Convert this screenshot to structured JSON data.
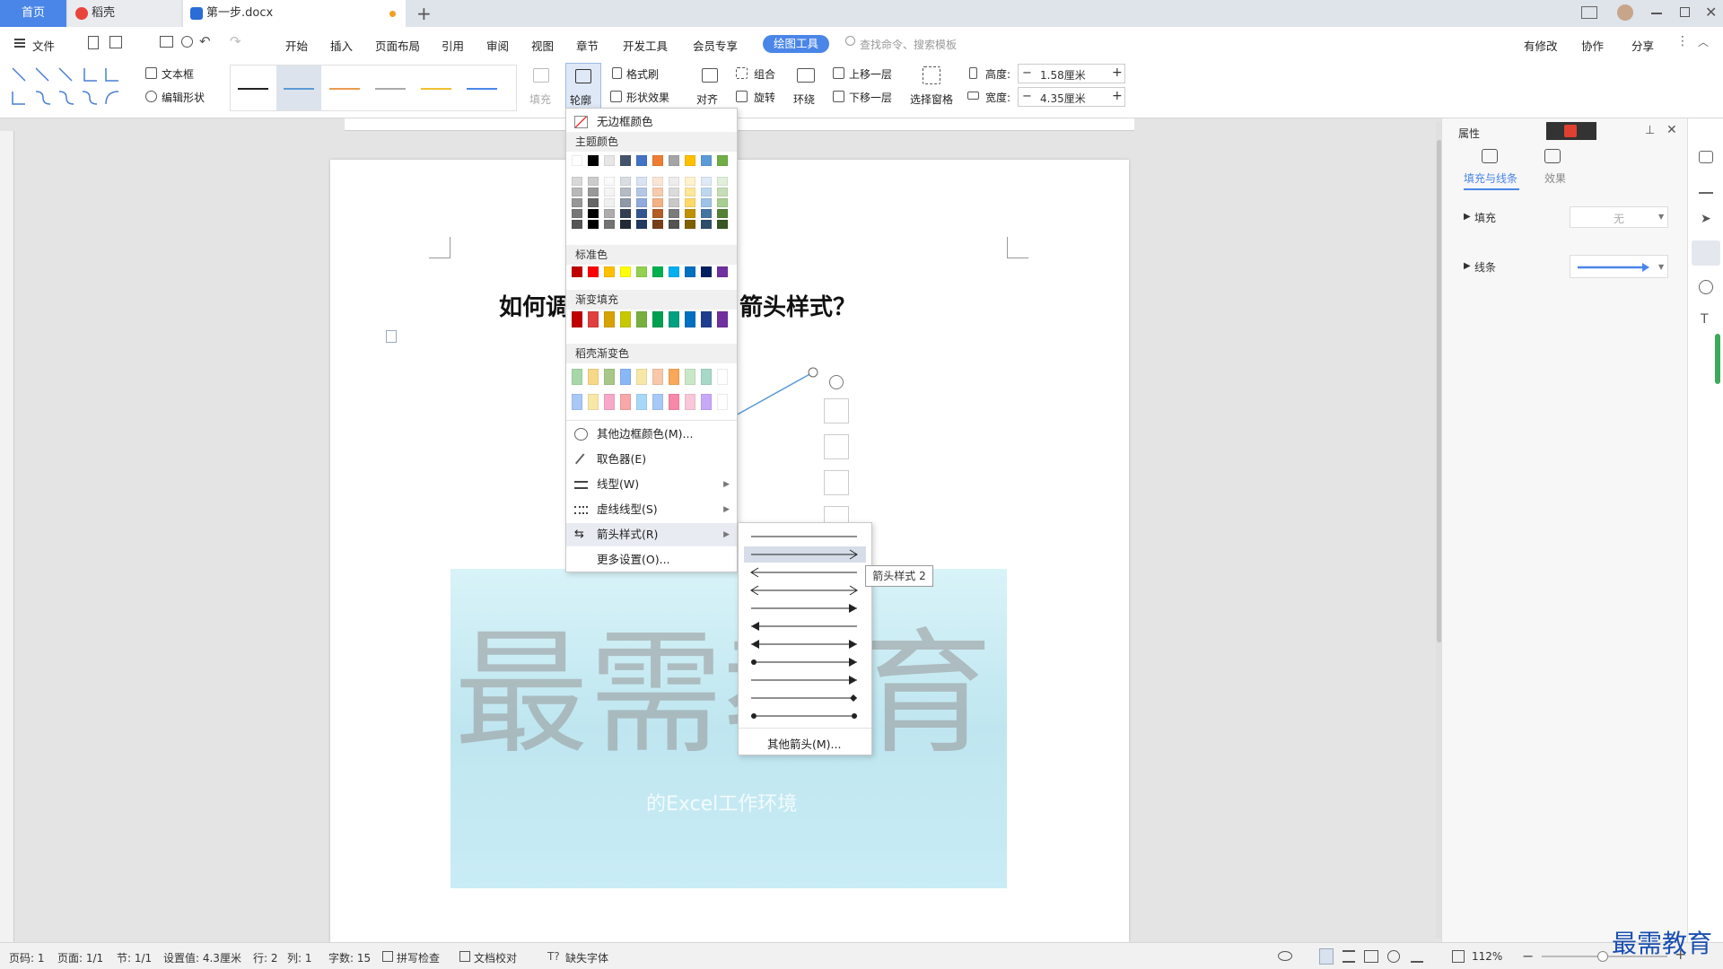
{
  "tabs": {
    "home": "首页",
    "daoke": "稻壳",
    "doc": "第一步.docx",
    "add": "+"
  },
  "menu": {
    "file": "文件",
    "items": [
      "开始",
      "插入",
      "页面布局",
      "引用",
      "审阅",
      "视图",
      "章节",
      "开发工具",
      "会员专享"
    ],
    "active_tool": "绘图工具",
    "search_placeholder": "查找命令、搜索模板",
    "right": [
      "有修改",
      "协作",
      "分享"
    ]
  },
  "ribbon": {
    "textbox": "文本框",
    "edit_shape": "编辑形状",
    "fill": "填充",
    "outline": "轮廓",
    "format_brush": "格式刷",
    "shape_effect": "形状效果",
    "align": "对齐",
    "group": "组合",
    "rotate": "旋转",
    "wrap": "环绕",
    "bring_forward": "上移一层",
    "send_backward": "下移一层",
    "selection_pane": "选择窗格",
    "height_label": "高度:",
    "height_value": "1.58厘米",
    "width_label": "宽度:",
    "width_value": "4.35厘米"
  },
  "document": {
    "title_left": "如何调",
    "title_right": "箭头样式？",
    "watermark_big": "最需教育",
    "watermark_sub": "的Excel工作环境"
  },
  "outline_menu": {
    "no_border": "无边框颜色",
    "theme_colors": "主题颜色",
    "standard_colors": "标准色",
    "gradient_fill": "渐变填充",
    "daoke_gradient": "稻壳渐变色",
    "more_colors": "其他边框颜色(M)...",
    "picker": "取色器(E)",
    "line_type": "线型(W)",
    "dash_type": "虚线线型(S)",
    "arrow_style": "箭头样式(R)",
    "more_settings": "更多设置(O)..."
  },
  "arrow_submenu": {
    "more_arrows": "其他箭头(M)...",
    "tooltip": "箭头样式 2"
  },
  "right_panel": {
    "title": "属性",
    "tab_fill": "填充与线条",
    "tab_effect": "效果",
    "fill_label": "填充",
    "fill_value": "无",
    "line_label": "线条"
  },
  "status": {
    "page_code": "页码: 1",
    "page": "页面: 1/1",
    "section": "节: 1/1",
    "setting": "设置值: 4.3厘米",
    "row": "行: 2",
    "col": "列: 1",
    "words": "字数: 15",
    "spell": "拼写检查",
    "proof": "文档校对",
    "missing_font": "缺失字体",
    "zoom": "112%"
  },
  "brand_watermark": "最需教育",
  "colors": {
    "accent": "#4a86e8",
    "theme_row": [
      "#ffffff",
      "#000000",
      "#e7e6e6",
      "#44546a",
      "#4472c4",
      "#ed7d31",
      "#a5a5a5",
      "#ffc000",
      "#5b9bd5",
      "#70ad47"
    ],
    "standard": [
      "#c00000",
      "#ff0000",
      "#ffc000",
      "#ffff00",
      "#92d050",
      "#00b050",
      "#00b0f0",
      "#0070c0",
      "#002060",
      "#7030a0"
    ],
    "gradient": [
      "#c00000",
      "#e04040",
      "#d6a300",
      "#c8c800",
      "#78b040",
      "#00a050",
      "#00a080",
      "#0070c0",
      "#1f3d8f",
      "#7030a0"
    ],
    "daoke1": [
      "#a8d8a8",
      "#f8d888",
      "#a8c888",
      "#88b8f8",
      "#f8e8a8",
      "#f8c8a8",
      "#f8a858",
      "#c8e8c8",
      "#a8d8c8",
      "#ffffff"
    ],
    "daoke2": [
      "#a8c8f8",
      "#f8e8a8",
      "#f8a8c8",
      "#f8a8a8",
      "#a8d8f8",
      "#a8c8f8",
      "#f888a8",
      "#f8c8d8",
      "#c8a8f8",
      "#ffffff"
    ]
  }
}
